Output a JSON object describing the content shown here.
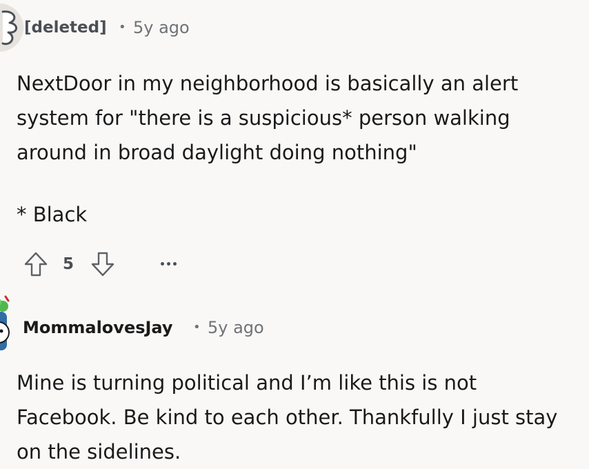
{
  "comments": [
    {
      "author": "[deleted]",
      "separator": "•",
      "time": "5y ago",
      "body": "NextDoor in my neighborhood is basically an alert\nsystem for \"there is a suspicious* person walking\naround in broad daylight doing nothing\"",
      "footnote": "* Black",
      "score": "5",
      "avatar_icon": "deleted-user-avatar"
    },
    {
      "author": "MommalovesJay",
      "separator": "•",
      "time": "5y ago",
      "body": "Mine is turning political and I’m like this is not\nFacebook. Be kind to each other. Thankfully I just stay\non the sidelines.",
      "avatar_icon": "user-avatar"
    }
  ],
  "icons": {
    "upvote": "upvote-icon",
    "downvote": "downvote-icon",
    "more": "more-options-icon"
  },
  "colors": {
    "background": "#f9f8f7",
    "text": "#1a1a1b",
    "meta": "#6f7276"
  }
}
